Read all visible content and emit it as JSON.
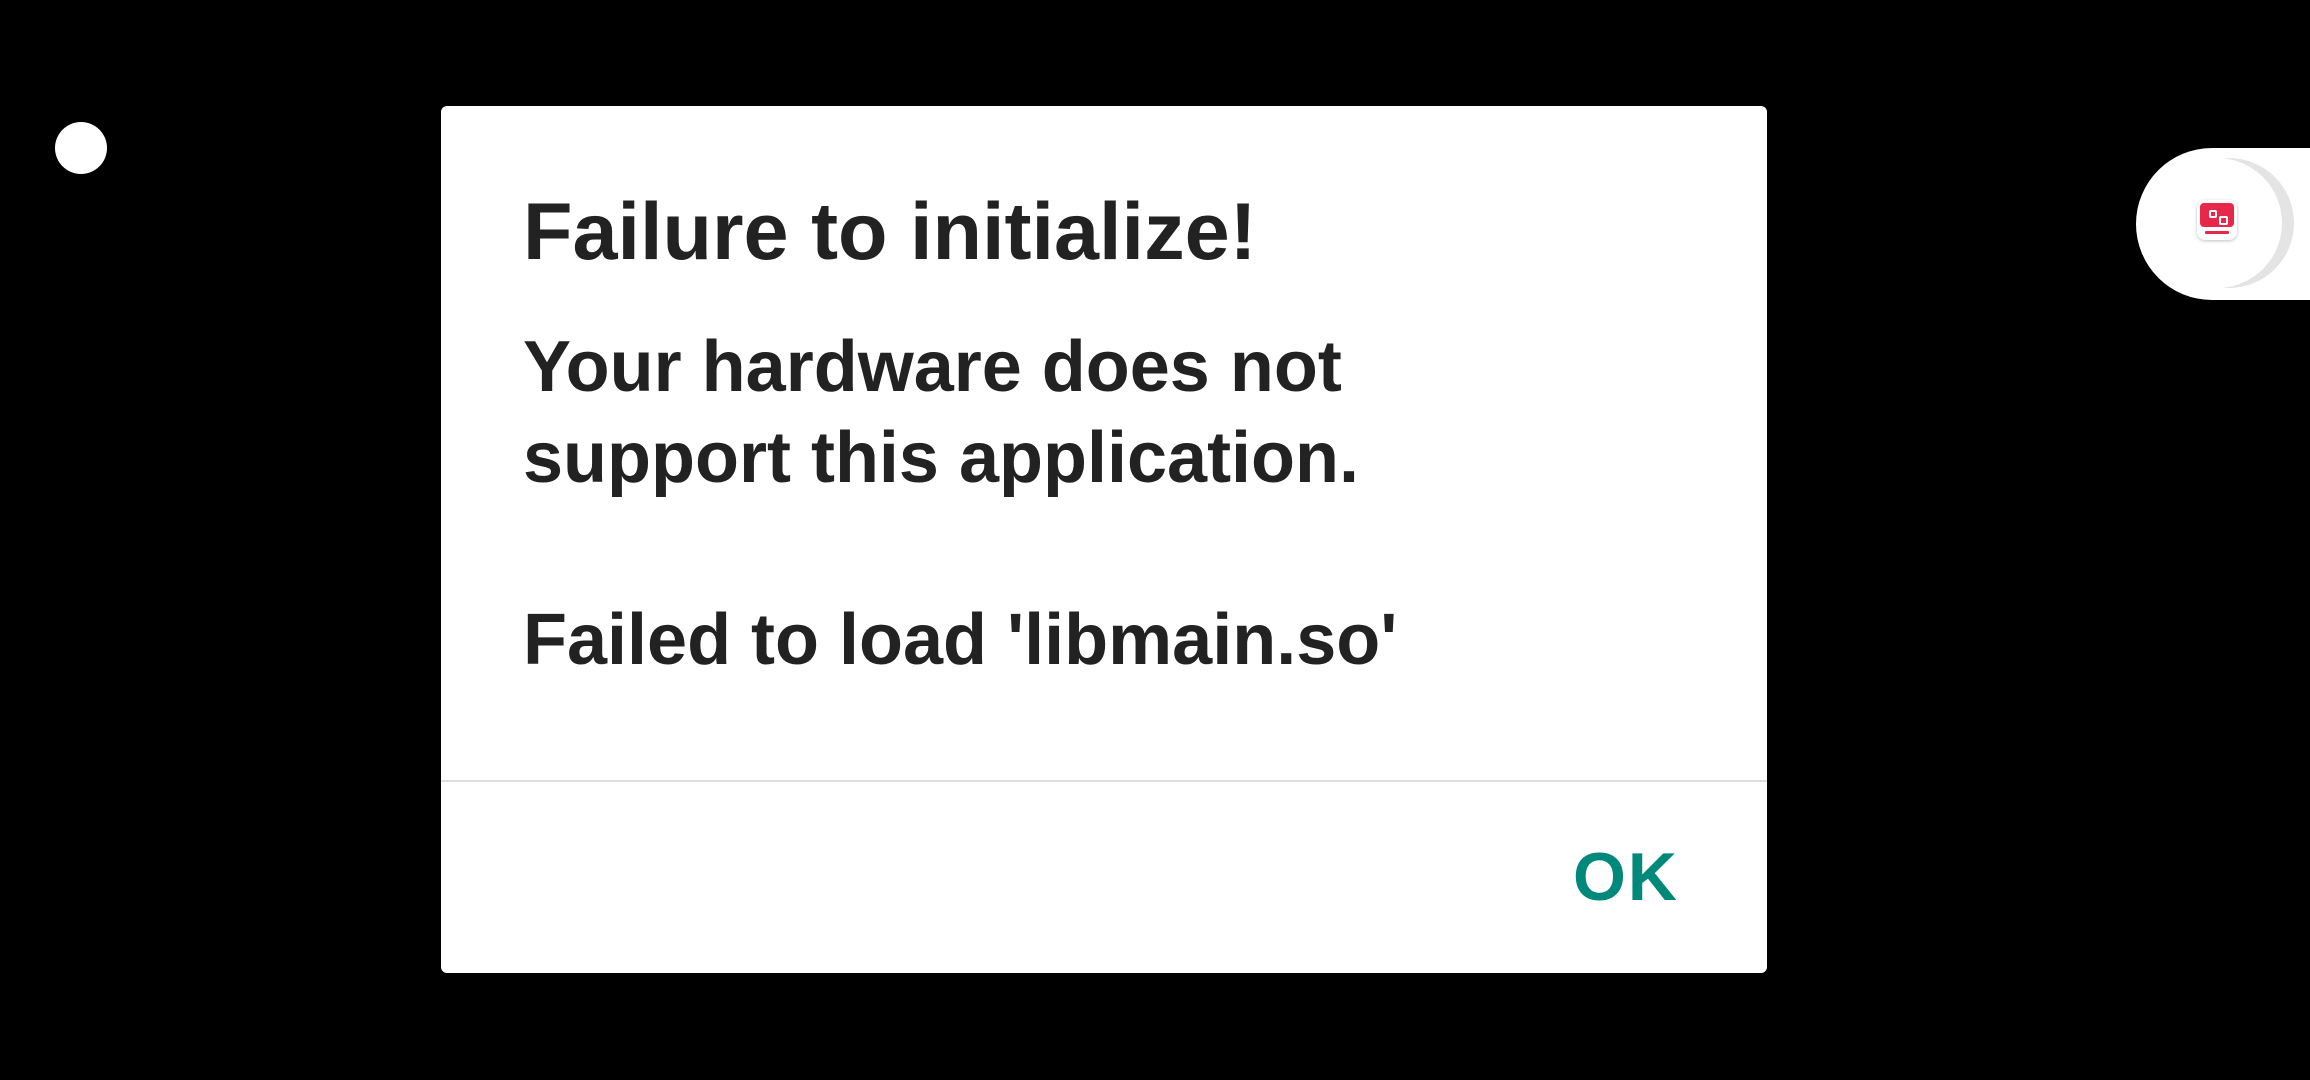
{
  "dialog": {
    "title": "Failure to initialize!",
    "message": "Your hardware does not\nsupport this application.\n\nFailed to load 'libmain.so'",
    "ok_label": "OK"
  },
  "colors": {
    "background": "#000000",
    "dialog_background": "#ffffff",
    "text": "#222222",
    "accent": "#00897b",
    "divider": "#dddddd",
    "app_icon_brand": "#e8284a"
  },
  "floating_bubble": {
    "icon": "app-shortcut-icon"
  }
}
